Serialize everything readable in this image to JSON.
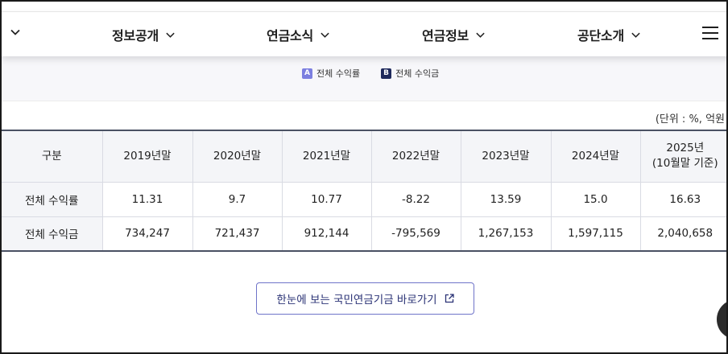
{
  "nav": {
    "items": [
      {
        "label": "정보공개"
      },
      {
        "label": "연금소식"
      },
      {
        "label": "연금정보"
      },
      {
        "label": "공단소개"
      }
    ],
    "icons": {
      "left": "chevron-down-icon",
      "menu": "hamburger-menu-icon"
    }
  },
  "legend": {
    "a": {
      "badge": "A",
      "label": "전체 수익률",
      "color": "#7c7fe0"
    },
    "b": {
      "badge": "B",
      "label": "전체 수익금",
      "color": "#1f2a5c"
    }
  },
  "unit": "(단위 : %, 억원",
  "table": {
    "header": {
      "category": "구분",
      "years": [
        "2019년말",
        "2020년말",
        "2021년말",
        "2022년말",
        "2023년말",
        "2024년말"
      ],
      "last_line1": "2025년",
      "last_line2": "(10월말 기준)"
    },
    "rows": [
      {
        "label": "전체 수익률",
        "values": [
          "11.31",
          "9.7",
          "10.77",
          "-8.22",
          "13.59",
          "15.0",
          "16.63"
        ]
      },
      {
        "label": "전체 수익금",
        "values": [
          "734,247",
          "721,437",
          "912,144",
          "-795,569",
          "1,267,153",
          "1,597,115",
          "2,040,658"
        ]
      }
    ]
  },
  "link_button": {
    "label": "한눈에 보는 국민연금기금 바로가기",
    "icon": "external-link-icon"
  },
  "colors": {
    "header_border": "#4a5163",
    "accent": "#6f74c9",
    "button_text": "#2a3275"
  }
}
